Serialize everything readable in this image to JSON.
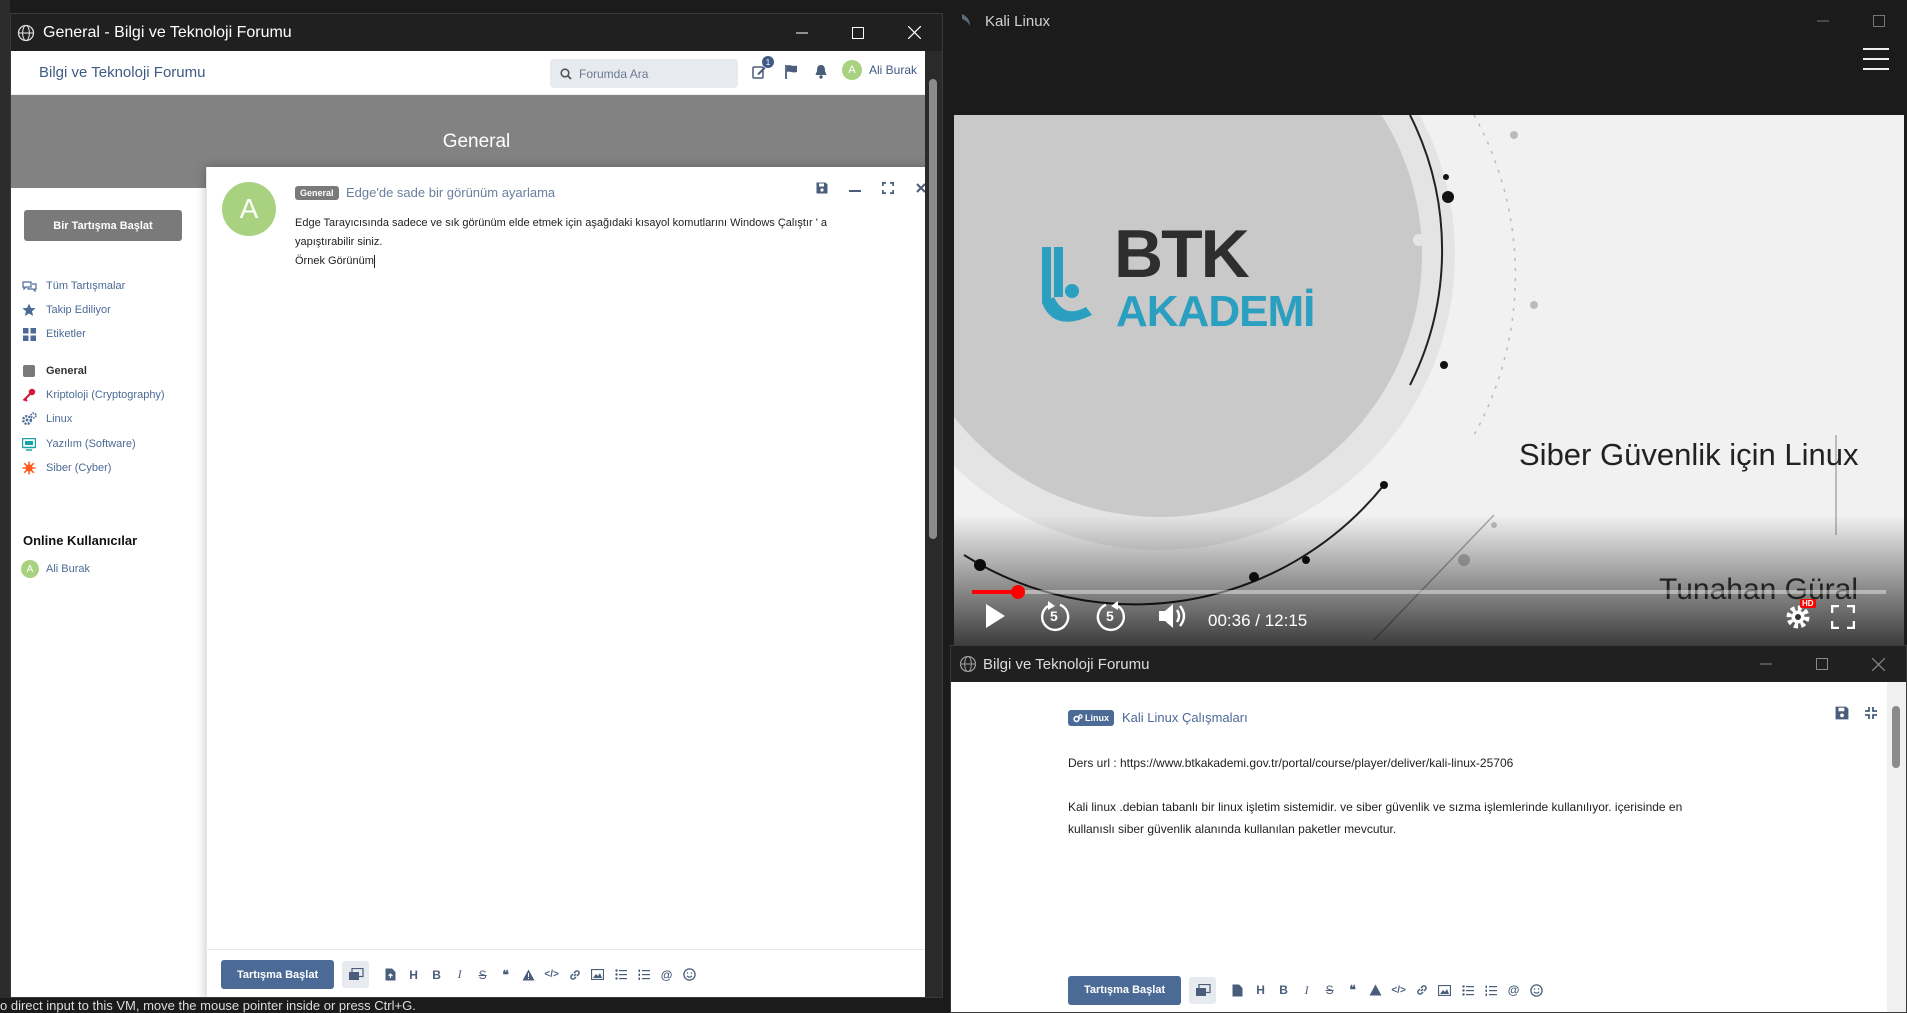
{
  "left_window": {
    "title": "General - Bilgi ve Teknoloji Forumu",
    "forum_title": "Bilgi ve Teknoloji Forumu",
    "search_placeholder": "Forumda Ara",
    "notification_count": "1",
    "user_name": "Ali Burak",
    "user_initial": "A",
    "hero_title": "General",
    "start_button": "Bir Tartışma Başlat",
    "nav": [
      {
        "label": "Tüm Tartışmalar",
        "icon": "comments-icon"
      },
      {
        "label": "Takip Ediliyor",
        "icon": "star-icon"
      },
      {
        "label": "Etiketler",
        "icon": "grid-icon"
      }
    ],
    "tags": [
      {
        "label": "General",
        "icon": "square-icon",
        "color": "#7a7a7a"
      },
      {
        "label": "Kriptoloji (Cryptography)",
        "icon": "key-icon",
        "color": "#d4173b"
      },
      {
        "label": "Linux",
        "icon": "gears-icon",
        "color": "#4c6a96"
      },
      {
        "label": "Yazılım (Software)",
        "icon": "monitor-icon",
        "color": "#1aa3a3"
      },
      {
        "label": "Siber (Cyber)",
        "icon": "virus-icon",
        "color": "#ff5a1f"
      }
    ],
    "online_title": "Online Kullanıcılar",
    "online_users": [
      {
        "name": "Ali Burak",
        "initial": "A"
      }
    ],
    "composer": {
      "tag": "General",
      "title": "Edge'de sade bir görünüm ayarlama",
      "line1": "Edge Tarayıcısında sadece ve sık görünüm elde etmek   için aşağıdaki kısayol  komutlarını Windows Çalıştır ' a",
      "line2": "yapıştırabilir siniz.",
      "line3": "Örnek Görünüm",
      "submit": "Tartışma Başlat"
    }
  },
  "right_top_window": {
    "title": "Kali Linux",
    "video": {
      "logo_line1": "BTK",
      "logo_line2": "AKADEMİ",
      "subtitle": "Siber Güvenlik için Linux",
      "author": "Tunahan Güral",
      "time": "00:36 / 12:15",
      "progress_fraction": 0.05,
      "skip_back": "5",
      "skip_fwd": "5",
      "hd_badge": "HD"
    }
  },
  "right_bottom_window": {
    "title": "Bilgi ve Teknoloji Forumu",
    "tag": "Linux",
    "discussion_title": "Kali Linux Çalışmaları",
    "body_line1": "Ders url : https://www.btkakademi.gov.tr/portal/course/player/deliver/kali-linux-25706",
    "body_line2": "Kali linux .debian tabanlı  bir linux işletim sistemidir. ve siber güvenlik ve sızma işlemlerinde kullanılıyor. içerisinde en",
    "body_line3": "kullanıslı  siber güvenlik alanında kullanılan paketler mevcutur.",
    "submit": "Tartışma Başlat"
  },
  "status_strip": "o direct input to this VM, move the mouse pointer inside or press Ctrl+G.",
  "colors": {
    "brand": "#4c6a96",
    "hero": "#828282",
    "avatar": "#a8d27f",
    "progress": "#ff0000"
  }
}
